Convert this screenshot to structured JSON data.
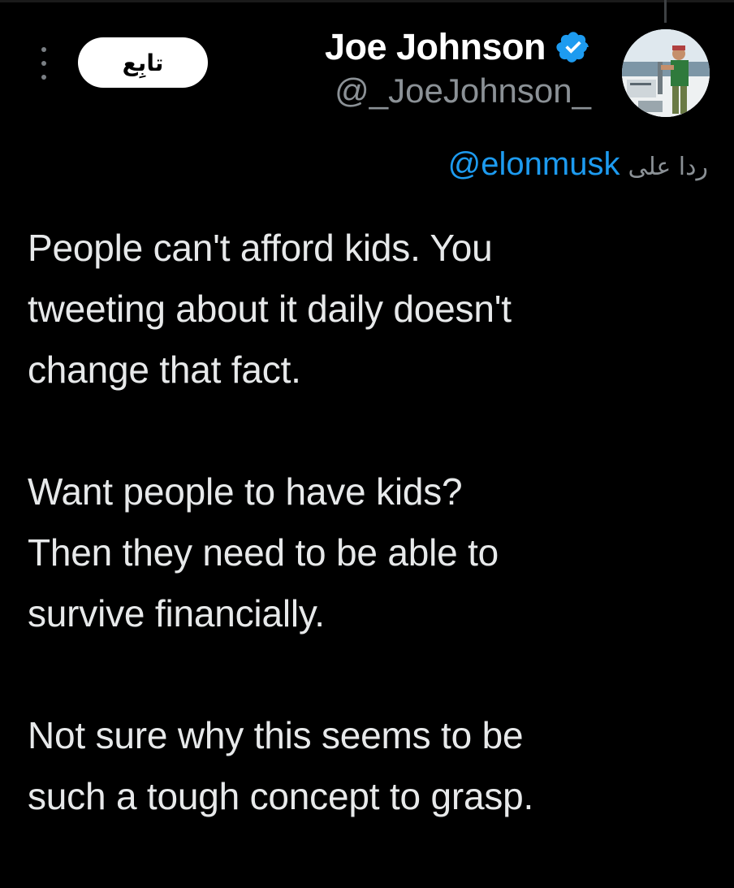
{
  "tweet": {
    "author": {
      "display_name": "Joe Johnson",
      "handle": "@_JoeJohnson_",
      "verified": true,
      "verified_icon": "verified-badge-icon",
      "avatar_icon": "avatar-photo"
    },
    "follow_label": "تابِع",
    "more_icon": "more-options-icon",
    "reply_prefix": "ردا على",
    "reply_mention": "@elonmusk",
    "paragraphs": [
      "People can't afford kids. You\ntweeting about it daily doesn't\nchange that fact.",
      "Want people to have kids?\nThen they need to be able to\nsurvive financially.",
      "Not sure why this seems to be\nsuch a tough concept to grasp."
    ]
  },
  "colors": {
    "background": "#000000",
    "text": "#e7e9ea",
    "muted": "#8b9196",
    "link": "#1d9bf0",
    "verified": "#1d9bf0",
    "button_bg": "#ffffff",
    "button_text": "#000000"
  }
}
